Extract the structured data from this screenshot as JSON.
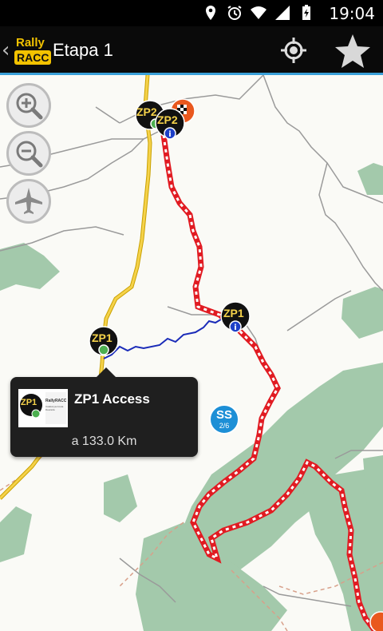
{
  "status_bar": {
    "time": "19:04",
    "icons": [
      "location-icon",
      "alarm-icon",
      "wifi-icon",
      "signal-icon",
      "battery-charging-icon"
    ]
  },
  "app_bar": {
    "logo_line1": "Rally",
    "logo_line2": "RACC",
    "title": "Etapa 1",
    "locate_icon": "crosshair-icon",
    "favorite_icon": "star-icon"
  },
  "map_controls": {
    "zoom_in_icon": "zoom-in-icon",
    "zoom_out_icon": "zoom-out-icon",
    "flight_icon": "airplane-icon"
  },
  "markers": {
    "zp2_top_label": "ZP2",
    "zp2_info_label": "ZP2",
    "zp1_info_label": "ZP1",
    "zp1_access_label": "ZP1",
    "ss_label": "SS",
    "ss_sub": "2/6"
  },
  "popup": {
    "thumb_label": "ZP1",
    "thumb_caption_1": "RallyRACC",
    "thumb_caption_2": "Catalunya-Costa Daurada",
    "title": "ZP1 Access",
    "distance": "a 133.0 Km"
  },
  "colors": {
    "accent": "#3aa0d8",
    "route_red": "#e11b22",
    "forest": "#9fc6a8",
    "road_yellow": "#f0c419",
    "access_blue": "#1a2bb8"
  }
}
